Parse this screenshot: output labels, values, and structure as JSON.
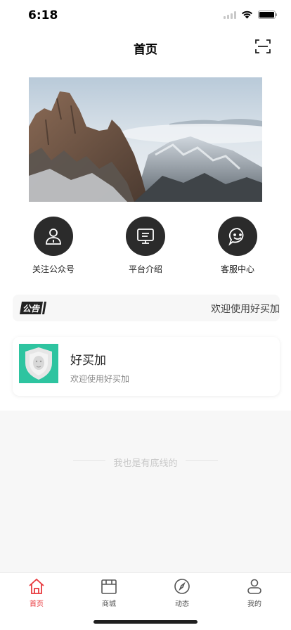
{
  "status_bar": {
    "time": "6:18"
  },
  "nav": {
    "title": "首页",
    "scan_icon": "scan-icon"
  },
  "quick_menu": [
    {
      "label": "关注公众号",
      "icon": "user-icon"
    },
    {
      "label": "平台介绍",
      "icon": "monitor-icon"
    },
    {
      "label": "客服中心",
      "icon": "chat-icon"
    }
  ],
  "notice": {
    "tag": "公告",
    "text": "欢迎使用好买加"
  },
  "store_card": {
    "name": "好买加",
    "description": "欢迎使用好买加"
  },
  "footer": {
    "end_text": "我也是有底线的"
  },
  "tabs": [
    {
      "label": "首页",
      "icon": "home-icon",
      "active": true
    },
    {
      "label": "商城",
      "icon": "shop-icon",
      "active": false
    },
    {
      "label": "动态",
      "icon": "compass-icon",
      "active": false
    },
    {
      "label": "我的",
      "icon": "profile-icon",
      "active": false
    }
  ],
  "colors": {
    "accent": "#e8383d",
    "icon_circle": "#2b2b2b",
    "thumb_bg": "#2ec4a0"
  }
}
